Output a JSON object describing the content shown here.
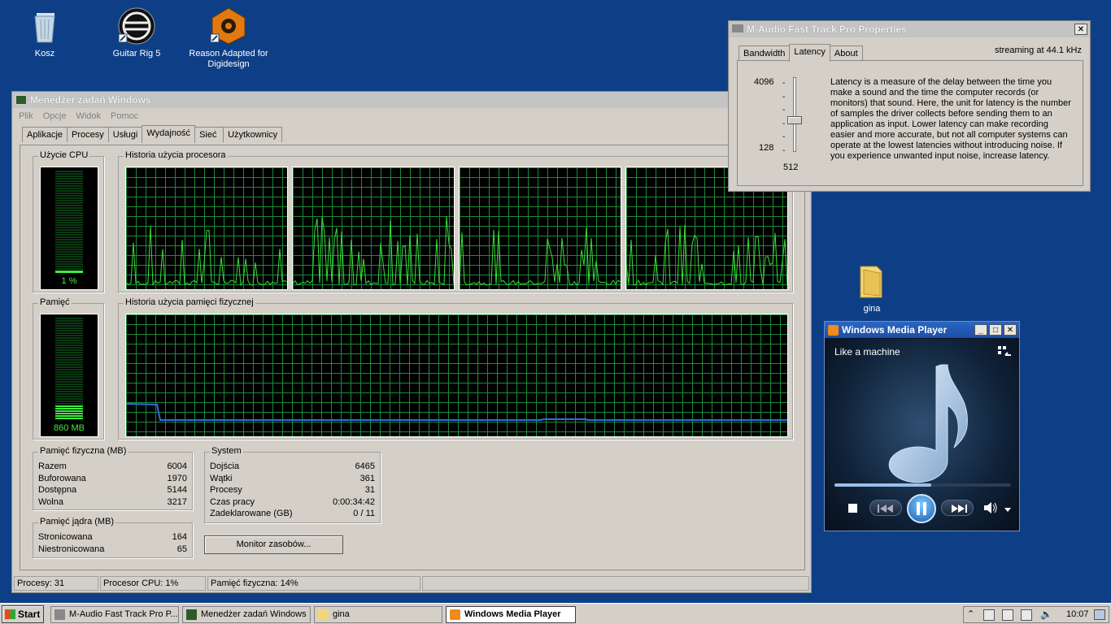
{
  "desktop": {
    "icons": [
      {
        "label": "Kosz",
        "icon": "recycle-bin-icon"
      },
      {
        "label": "Guitar Rig 5",
        "icon": "guitar-rig-icon"
      },
      {
        "label": "Reason Adapted for Digidesign",
        "icon": "reason-icon"
      },
      {
        "label": "gina",
        "icon": "folder-icon"
      }
    ]
  },
  "taskmgr": {
    "title": "Menedżer zadań Windows",
    "menu": [
      "Plik",
      "Opcje",
      "Widok",
      "Pomoc"
    ],
    "tabs": [
      "Aplikacje",
      "Procesy",
      "Usługi",
      "Wydajność",
      "Sieć",
      "Użytkownicy"
    ],
    "selected_tab": "Wydajność",
    "cpu_usage_label": "Użycie CPU",
    "cpu_value": "1 %",
    "cpu_history_label": "Historia użycia procesora",
    "memory_label": "Pamięć",
    "memory_value": "860 MB",
    "memory_history_label": "Historia użycia pamięci fizycznej",
    "physical": {
      "title": "Pamięć fizyczna (MB)",
      "rows": [
        {
          "k": "Razem",
          "v": "6004"
        },
        {
          "k": "Buforowana",
          "v": "1970"
        },
        {
          "k": "Dostępna",
          "v": "5144"
        },
        {
          "k": "Wolna",
          "v": "3217"
        }
      ]
    },
    "kernel": {
      "title": "Pamięć jądra (MB)",
      "rows": [
        {
          "k": "Stronicowana",
          "v": "164"
        },
        {
          "k": "Niestronicowana",
          "v": "65"
        }
      ]
    },
    "system": {
      "title": "System",
      "rows": [
        {
          "k": "Dojścia",
          "v": "6465"
        },
        {
          "k": "Wątki",
          "v": "361"
        },
        {
          "k": "Procesy",
          "v": "31"
        },
        {
          "k": "Czas pracy",
          "v": "0:00:34:42"
        },
        {
          "k": "Zadeklarowane (GB)",
          "v": "0 / 11"
        }
      ]
    },
    "resource_monitor_button": "Monitor zasobów...",
    "status": {
      "processes": "Procesy: 31",
      "cpu": "Procesor CPU: 1%",
      "memory": "Pamięć fizyczna: 14%"
    }
  },
  "maudio": {
    "title": "M-Audio Fast Track Pro Properties",
    "tabs": [
      "Bandwidth",
      "Latency",
      "About"
    ],
    "selected_tab": "Latency",
    "streaming": "streaming at 44.1 kHz",
    "slider_max_label": "4096",
    "slider_min_label": "128",
    "slider_value": "512",
    "description": "Latency is a measure of the delay between the time you make a sound and the time the computer records (or monitors) that sound. Here, the unit for latency is the number of samples the driver collects before sending them to an application as input. Lower latency can make recording easier and more accurate, but not all computer systems can operate at the lowest latencies without introducing noise. If you experience unwanted input noise, increase latency."
  },
  "wmp": {
    "title": "Windows Media Player",
    "track": "Like a machine",
    "progress": 0.55
  },
  "taskbar": {
    "start": "Start",
    "tasks": [
      {
        "label": "M-Audio Fast Track Pro P...",
        "active": false
      },
      {
        "label": "Menedżer zadań Windows",
        "active": false
      },
      {
        "label": "gina",
        "active": false
      },
      {
        "label": "Windows Media Player",
        "active": true
      }
    ],
    "clock": "10:07"
  },
  "colors": {
    "desktop": "#0e3f86",
    "graph_line": "#35e035",
    "memory_line": "#2d6fe0",
    "grid": "#1c8a3a"
  }
}
